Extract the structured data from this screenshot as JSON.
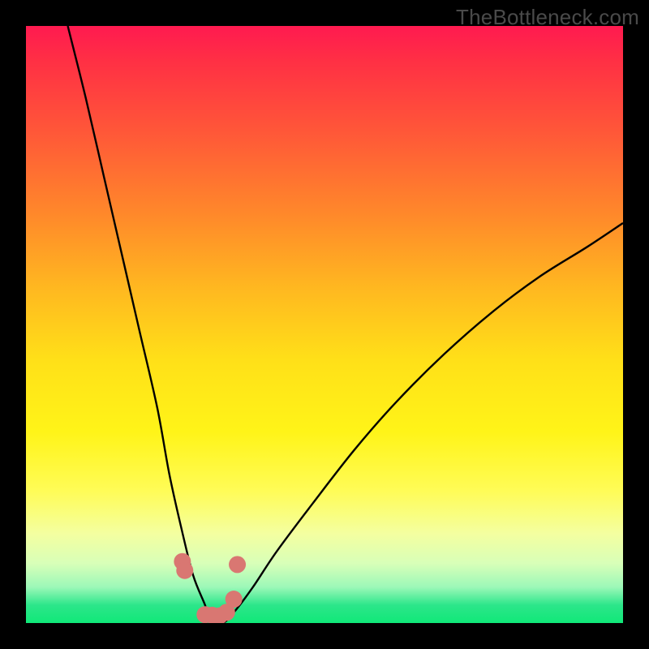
{
  "watermark": "TheBottleneck.com",
  "chart_data": {
    "type": "line",
    "title": "",
    "xlabel": "",
    "ylabel": "",
    "xlim": [
      0,
      100
    ],
    "ylim": [
      0,
      100
    ],
    "series": [
      {
        "name": "bottleneck-curve",
        "x": [
          7,
          10,
          13,
          16,
          19,
          22,
          24,
          26,
          28,
          30,
          31,
          33,
          35,
          38,
          42,
          48,
          55,
          62,
          70,
          78,
          86,
          94,
          100
        ],
        "y": [
          100,
          88,
          75,
          62,
          49,
          36,
          25,
          16,
          8,
          3,
          0,
          0,
          2,
          6,
          12,
          20,
          29,
          37,
          45,
          52,
          58,
          63,
          67
        ]
      },
      {
        "name": "marker-dots",
        "x": [
          26.2,
          26.6,
          30.0,
          31.2,
          32.4,
          33.6,
          34.8,
          35.4
        ],
        "y": [
          10.3,
          8.8,
          1.4,
          1.3,
          1.2,
          1.8,
          4.0,
          9.8
        ]
      }
    ],
    "marker_color": "#d97772",
    "curve_color": "#000000"
  }
}
